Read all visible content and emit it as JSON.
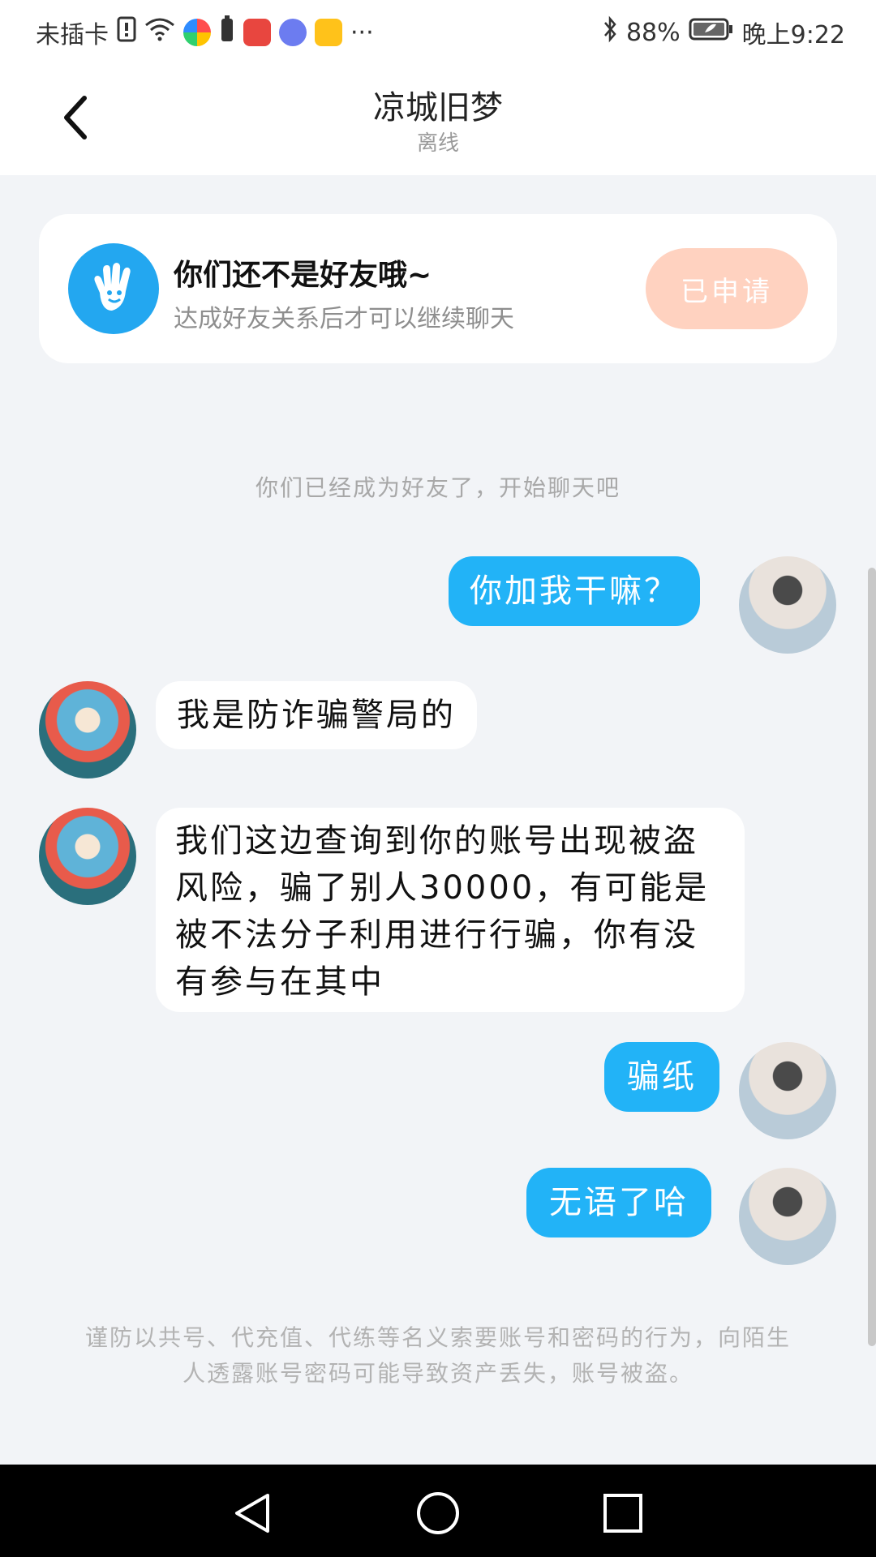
{
  "status_bar": {
    "carrier": "未插卡",
    "more": "···",
    "battery": "88%",
    "time": "晚上9:22",
    "icons": [
      "sim-alert-icon",
      "wifi-icon",
      "app-icon-colorful",
      "battery-saver-icon",
      "app-icon-huawei",
      "app-icon-music",
      "app-icon-yellow",
      "bluetooth-icon",
      "battery-icon"
    ]
  },
  "header": {
    "title": "凉城旧梦",
    "status": "离线"
  },
  "friend_card": {
    "title": "你们还不是好友哦~",
    "subtitle": "达成好友关系后才可以继续聊天",
    "button": "已申请"
  },
  "system_message": "你们已经成为好友了，开始聊天吧",
  "messages": [
    {
      "side": "out",
      "text": "你加我干嘛？"
    },
    {
      "side": "in",
      "text": "我是防诈骗警局的"
    },
    {
      "side": "in",
      "text": "我们这边查询到你的账号出现被盗风险，骗了别人30000，有可能是被不法分子利用进行行骗，你有没有参与在其中"
    },
    {
      "side": "out",
      "text": "骗纸"
    },
    {
      "side": "out",
      "text": "无语了哈"
    }
  ],
  "warning": "谨防以共号、代充值、代练等名义索要账号和密码的行为，向陌生人透露账号密码可能导致资产丢失，账号被盗。",
  "colors": {
    "accent": "#22b3f7",
    "applied_button": "#ffd2c0",
    "background": "#f2f4f7"
  }
}
